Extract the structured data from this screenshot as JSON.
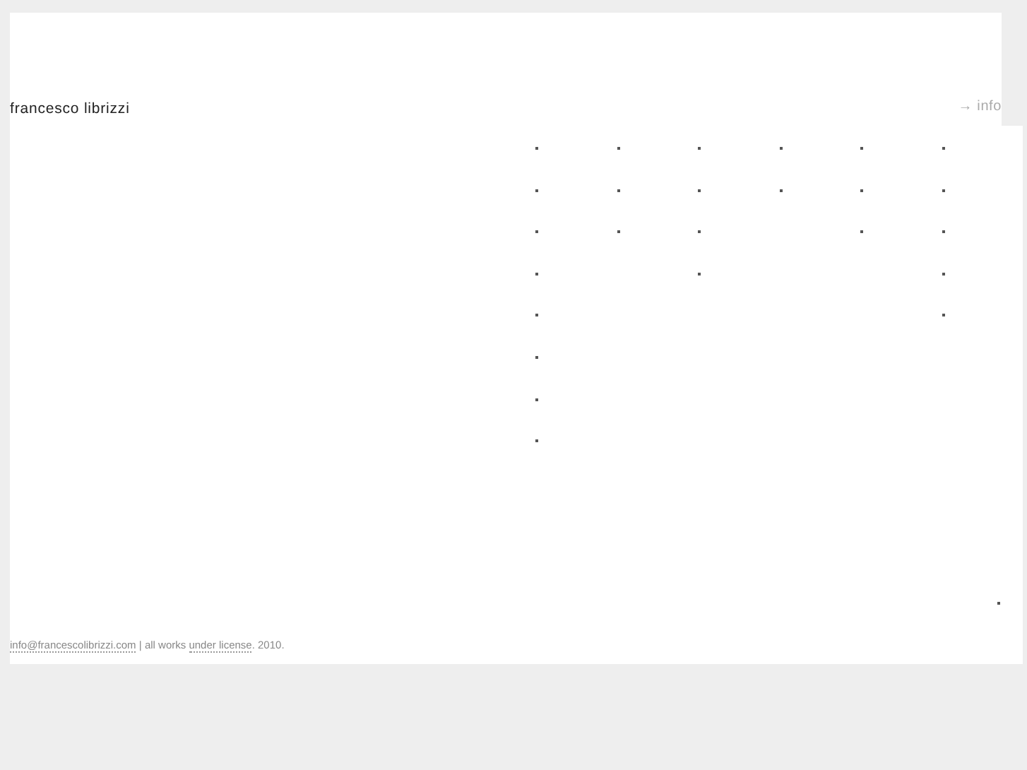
{
  "header": {
    "title": "francesco librizzi",
    "info_link": {
      "arrow": "→",
      "label": "info"
    }
  },
  "dot_columns": [
    {
      "dots": [
        {
          "kind": "dot"
        },
        {
          "kind": "dot"
        },
        {
          "kind": "dot"
        },
        {
          "kind": "dot"
        },
        {
          "kind": "dot"
        },
        {
          "kind": "dot"
        },
        {
          "kind": "dot"
        },
        {
          "kind": "dot"
        }
      ]
    },
    {
      "dots": [
        {
          "kind": "dot"
        },
        {
          "kind": "dot"
        },
        {
          "kind": "dot"
        }
      ]
    },
    {
      "dots": [
        {
          "kind": "dot"
        },
        {
          "kind": "dot"
        },
        {
          "kind": "dot"
        },
        {
          "kind": "dot"
        }
      ]
    },
    {
      "dots": [
        {
          "kind": "dot"
        },
        {
          "kind": "dot"
        }
      ]
    },
    {
      "dots": [
        {
          "kind": "dot"
        },
        {
          "kind": "dot"
        },
        {
          "kind": "dot"
        }
      ]
    },
    {
      "dots": [
        {
          "kind": "dot"
        },
        {
          "kind": "dot"
        },
        {
          "kind": "dot"
        },
        {
          "kind": "dot"
        },
        {
          "kind": "dot"
        }
      ]
    }
  ],
  "corner_dot": {
    "kind": "dot"
  },
  "footer": {
    "email": "info@francescolibrizzi.com",
    "separator": "| all works",
    "license_link": "under license",
    "year": ". 2010."
  }
}
